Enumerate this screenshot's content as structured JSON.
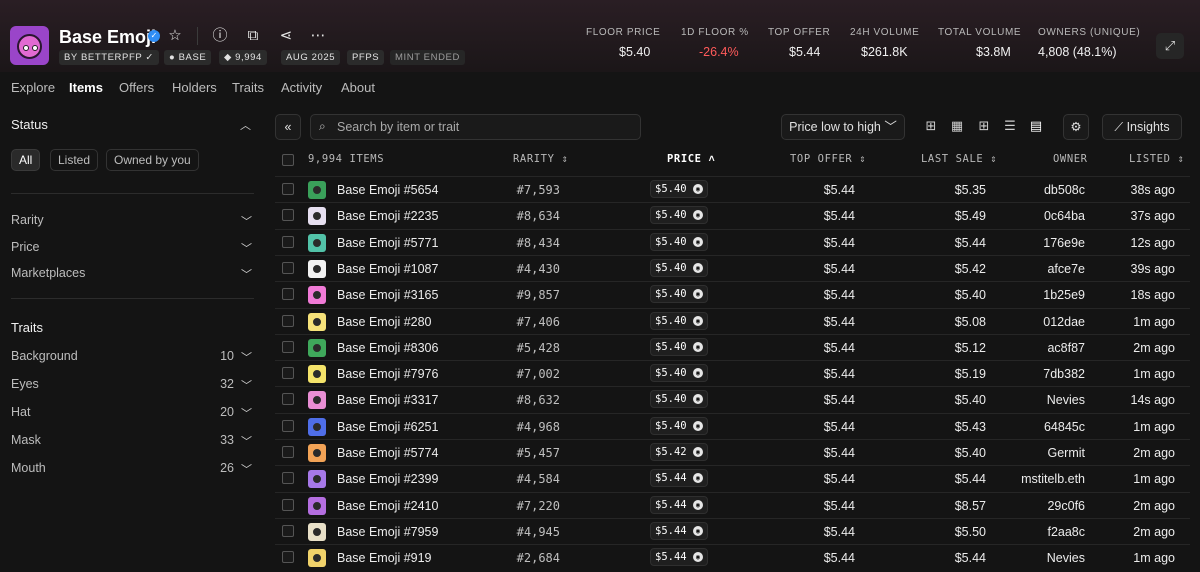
{
  "collection": {
    "title": "Base Emoji",
    "chips": [
      "BY BETTERPFP",
      "BASE",
      "9,994",
      "AUG 2025",
      "PFPS",
      "MINT ENDED"
    ]
  },
  "stats": [
    {
      "label": "FLOOR PRICE",
      "value": "$5.40"
    },
    {
      "label": "1D FLOOR %",
      "value": "-26.4%"
    },
    {
      "label": "TOP OFFER",
      "value": "$5.44"
    },
    {
      "label": "24H VOLUME",
      "value": "$261.8K"
    },
    {
      "label": "TOTAL VOLUME",
      "value": "$3.8M"
    },
    {
      "label": "OWNERS (UNIQUE)",
      "value": "4,808 (48.1%)"
    }
  ],
  "tabs": [
    "Explore",
    "Items",
    "Offers",
    "Holders",
    "Traits",
    "Activity",
    "About"
  ],
  "sidebar": {
    "status_heading": "Status",
    "status_pills": [
      "All",
      "Listed",
      "Owned by you"
    ],
    "filters": [
      "Rarity",
      "Price",
      "Marketplaces"
    ],
    "traits_heading": "Traits",
    "traits": [
      {
        "name": "Background",
        "count": "10"
      },
      {
        "name": "Eyes",
        "count": "32"
      },
      {
        "name": "Hat",
        "count": "20"
      },
      {
        "name": "Mask",
        "count": "33"
      },
      {
        "name": "Mouth",
        "count": "26"
      }
    ]
  },
  "toolbar": {
    "search_placeholder": "Search by item or trait",
    "sort_label": "Price low to high",
    "insights_label": "Insights"
  },
  "table": {
    "headers": {
      "items": "9,994 ITEMS",
      "rarity": "RARITY",
      "price": "PRICE",
      "top_offer": "TOP OFFER",
      "last_sale": "LAST SALE",
      "owner": "OWNER",
      "listed": "LISTED"
    },
    "rows": [
      {
        "name": "Base Emoji #5654",
        "rarity": "#7,593",
        "price": "$5.40",
        "top_offer": "$5.44",
        "last_sale": "$5.35",
        "owner": "db508c",
        "listed": "38s ago",
        "color": "#3aa05a"
      },
      {
        "name": "Base Emoji #2235",
        "rarity": "#8,634",
        "price": "$5.40",
        "top_offer": "$5.44",
        "last_sale": "$5.49",
        "owner": "0c64ba",
        "listed": "37s ago",
        "color": "#e6dff0"
      },
      {
        "name": "Base Emoji #5771",
        "rarity": "#8,434",
        "price": "$5.40",
        "top_offer": "$5.44",
        "last_sale": "$5.44",
        "owner": "176e9e",
        "listed": "12s ago",
        "color": "#52c2a8"
      },
      {
        "name": "Base Emoji #1087",
        "rarity": "#4,430",
        "price": "$5.40",
        "top_offer": "$5.44",
        "last_sale": "$5.42",
        "owner": "afce7e",
        "listed": "39s ago",
        "color": "#f2f2f2"
      },
      {
        "name": "Base Emoji #3165",
        "rarity": "#9,857",
        "price": "$5.40",
        "top_offer": "$5.44",
        "last_sale": "$5.40",
        "owner": "1b25e9",
        "listed": "18s ago",
        "color": "#f07ad6"
      },
      {
        "name": "Base Emoji #280",
        "rarity": "#7,406",
        "price": "$5.40",
        "top_offer": "$5.44",
        "last_sale": "$5.08",
        "owner": "012dae",
        "listed": "1m ago",
        "color": "#f6e27a"
      },
      {
        "name": "Base Emoji #8306",
        "rarity": "#5,428",
        "price": "$5.40",
        "top_offer": "$5.44",
        "last_sale": "$5.12",
        "owner": "ac8f87",
        "listed": "2m ago",
        "color": "#3fa85b"
      },
      {
        "name": "Base Emoji #7976",
        "rarity": "#7,002",
        "price": "$5.40",
        "top_offer": "$5.44",
        "last_sale": "$5.19",
        "owner": "7db382",
        "listed": "1m ago",
        "color": "#f4e36a"
      },
      {
        "name": "Base Emoji #3317",
        "rarity": "#8,632",
        "price": "$5.40",
        "top_offer": "$5.44",
        "last_sale": "$5.40",
        "owner": "Nevies",
        "listed": "14s ago",
        "color": "#e98ed4"
      },
      {
        "name": "Base Emoji #6251",
        "rarity": "#4,968",
        "price": "$5.40",
        "top_offer": "$5.44",
        "last_sale": "$5.43",
        "owner": "64845c",
        "listed": "1m ago",
        "color": "#4f6ee8"
      },
      {
        "name": "Base Emoji #5774",
        "rarity": "#5,457",
        "price": "$5.42",
        "top_offer": "$5.44",
        "last_sale": "$5.40",
        "owner": "Germit",
        "listed": "2m ago",
        "color": "#f2a356"
      },
      {
        "name": "Base Emoji #2399",
        "rarity": "#4,584",
        "price": "$5.44",
        "top_offer": "$5.44",
        "last_sale": "$5.44",
        "owner": "mstitelb.eth",
        "listed": "1m ago",
        "color": "#a678e8"
      },
      {
        "name": "Base Emoji #2410",
        "rarity": "#7,220",
        "price": "$5.44",
        "top_offer": "$5.44",
        "last_sale": "$8.57",
        "owner": "29c0f6",
        "listed": "2m ago",
        "color": "#b46ee0"
      },
      {
        "name": "Base Emoji #7959",
        "rarity": "#4,945",
        "price": "$5.44",
        "top_offer": "$5.44",
        "last_sale": "$5.50",
        "owner": "f2aa8c",
        "listed": "2m ago",
        "color": "#e8e0c8"
      },
      {
        "name": "Base Emoji #919",
        "rarity": "#2,684",
        "price": "$5.44",
        "top_offer": "$5.44",
        "last_sale": "$5.44",
        "owner": "Nevies",
        "listed": "1m ago",
        "color": "#f0d26a"
      }
    ]
  }
}
